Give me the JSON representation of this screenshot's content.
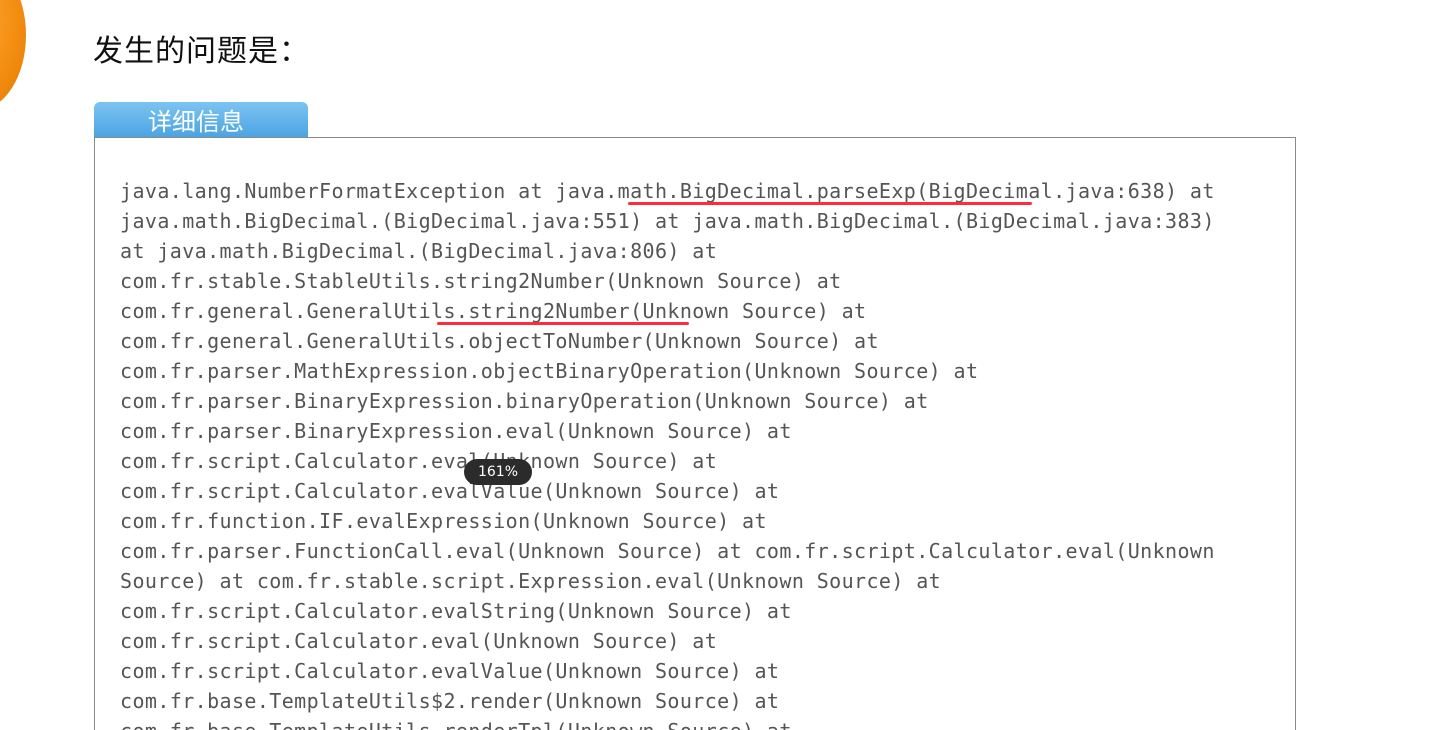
{
  "page": {
    "heading": "发生的问题是：",
    "details_tab_label": "详细信息",
    "zoom_level": "161%"
  },
  "stack_trace": [
    "java.lang.NumberFormatException at java.math.BigDecimal.parseExp(BigDecimal.java:638) at",
    "java.math.BigDecimal.(BigDecimal.java:551) at java.math.BigDecimal.(BigDecimal.java:383)",
    "at java.math.BigDecimal.(BigDecimal.java:806) at",
    "com.fr.stable.StableUtils.string2Number(Unknown Source) at",
    "com.fr.general.GeneralUtils.string2Number(Unknown Source) at",
    "com.fr.general.GeneralUtils.objectToNumber(Unknown Source) at",
    "com.fr.parser.MathExpression.objectBinaryOperation(Unknown Source) at",
    "com.fr.parser.BinaryExpression.binaryOperation(Unknown Source) at",
    "com.fr.parser.BinaryExpression.eval(Unknown Source) at",
    "com.fr.script.Calculator.eval(Unknown Source) at",
    "com.fr.script.Calculator.evalValue(Unknown Source) at",
    "com.fr.function.IF.evalExpression(Unknown Source) at",
    "com.fr.parser.FunctionCall.eval(Unknown Source) at com.fr.script.Calculator.eval(Unknown",
    "Source) at com.fr.stable.script.Expression.eval(Unknown Source) at",
    "com.fr.script.Calculator.evalString(Unknown Source) at",
    "com.fr.script.Calculator.eval(Unknown Source) at",
    "com.fr.script.Calculator.evalValue(Unknown Source) at",
    "com.fr.base.TemplateUtils$2.render(Unknown Source) at",
    "com.fr.base.TemplateUtils.renderTpl(Unknown Source) at"
  ],
  "colors": {
    "annotation": "#ff2d3c",
    "tab_blue": "#4aa3e2",
    "accent_orange": "#f59014"
  }
}
